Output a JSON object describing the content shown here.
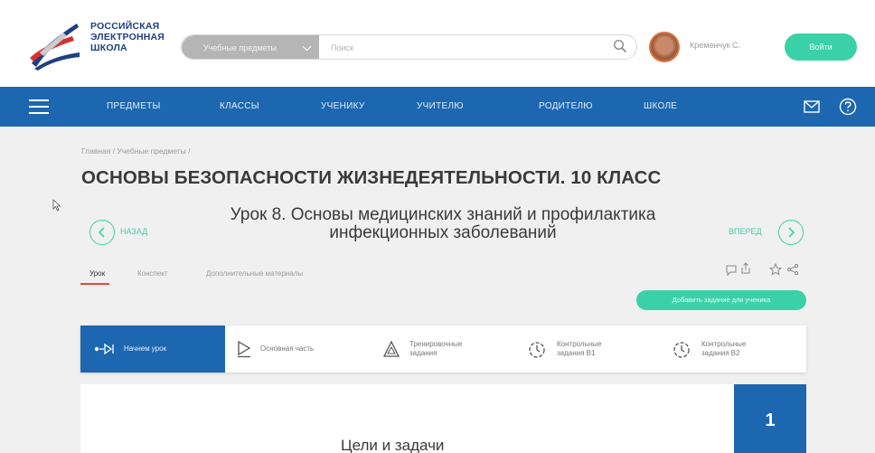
{
  "header": {
    "logo_text": [
      "РОССИЙСКАЯ",
      "ЭЛЕКТРОННАЯ",
      "ШКОЛА"
    ],
    "search_category": "Учебные предметы",
    "search_placeholder": "Поиск",
    "user_name": "Кременчук С.",
    "login_label": "Войти"
  },
  "nav": {
    "items": [
      "ПРЕДМЕТЫ",
      "КЛАССЫ",
      "УЧЕНИКУ",
      "УЧИТЕЛЮ",
      "РОДИТЕЛЮ",
      "ШКОЛЕ"
    ]
  },
  "main": {
    "breadcrumb": "Главная / Учебные предметы /",
    "page_title": "ОСНОВЫ БЕЗОПАСНОСТИ ЖИЗНЕДЕЯТЕЛЬНОСТИ. 10 КЛАСС",
    "prev_label": "НАЗАД",
    "next_label": "ВПЕРЕД",
    "lesson_title_line1": "Урок 8. Основы медицинских знаний и профилактика",
    "lesson_title_line2": "инфекционных заболеваний",
    "tabs": [
      "Урок",
      "Конспект",
      "Дополнительные материалы"
    ],
    "add_task_label": "Добавить задание для ученика",
    "steps": [
      {
        "label": "Начнем урок",
        "icon": "play-dot-icon"
      },
      {
        "label": "Основная часть",
        "icon": "play-square-icon"
      },
      {
        "label": "Тренировочные задания",
        "icon": "triangle-icon"
      },
      {
        "label": "Контрольные задания В1",
        "icon": "timer-icon"
      },
      {
        "label": "Контрольные задания В2",
        "icon": "timer-icon"
      }
    ],
    "slide_number": "1",
    "section_heading": "Цели и задачи"
  },
  "colors": {
    "brand_blue": "#1c67b0",
    "accent_green": "#3bd1a8",
    "active_tab_red": "#e8463a"
  }
}
